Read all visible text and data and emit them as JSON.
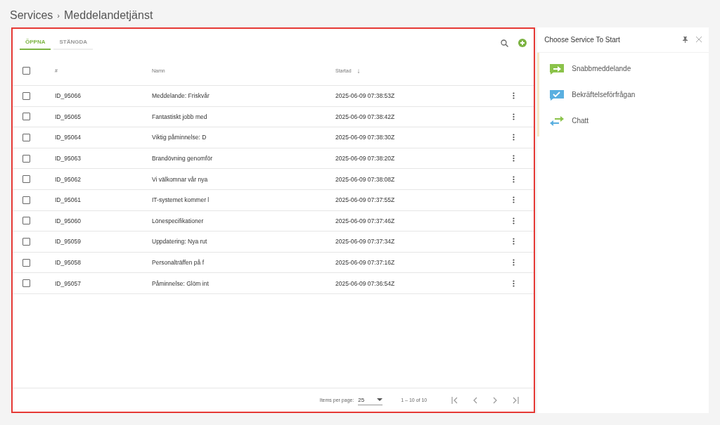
{
  "breadcrumb": {
    "parent": "Services",
    "separator": "›",
    "current": "Meddelandetjänst"
  },
  "tabs": [
    {
      "label": "ÖPPNA",
      "selected": true
    },
    {
      "label": "STÄNGDA",
      "selected": false
    }
  ],
  "table": {
    "all_checked": false,
    "columns": [
      "#",
      "Namn",
      "Startad"
    ],
    "sort_indicator": "↓",
    "rows": [
      {
        "id": "ID_95066",
        "name": "Meddelande: Friskvår",
        "started": "2025-06-09 07:38:53Z",
        "checked": false
      },
      {
        "id": "ID_95065",
        "name": "Fantastiskt jobb med",
        "started": "2025-06-09 07:38:42Z",
        "checked": false
      },
      {
        "id": "ID_95064",
        "name": "Viktig påminnelse: D",
        "started": "2025-06-09 07:38:30Z",
        "checked": false
      },
      {
        "id": "ID_95063",
        "name": "Brandövning genomför",
        "started": "2025-06-09 07:38:20Z",
        "checked": false
      },
      {
        "id": "ID_95062",
        "name": "Vi välkomnar vår nya",
        "started": "2025-06-09 07:38:08Z",
        "checked": false
      },
      {
        "id": "ID_95061",
        "name": "IT-systemet kommer l",
        "started": "2025-06-09 07:37:55Z",
        "checked": false
      },
      {
        "id": "ID_95060",
        "name": "Lönespecifikationer",
        "started": "2025-06-09 07:37:46Z",
        "checked": false
      },
      {
        "id": "ID_95059",
        "name": "Uppdatering: Nya rut",
        "started": "2025-06-09 07:37:34Z",
        "checked": false
      },
      {
        "id": "ID_95058",
        "name": "Personalträffen på f",
        "started": "2025-06-09 07:37:16Z",
        "checked": false
      },
      {
        "id": "ID_95057",
        "name": "Påminnelse: Glöm int",
        "started": "2025-06-09 07:36:54Z",
        "checked": false
      }
    ]
  },
  "paginator": {
    "label": "Items per page:",
    "page_size": "25",
    "range": "1 – 10 of 10"
  },
  "side_panel": {
    "title": "Choose Service To Start",
    "services": [
      {
        "label": "Snabbmeddelande",
        "kind": "message"
      },
      {
        "label": "Bekräftelseförfrågan",
        "kind": "confirm"
      },
      {
        "label": "Chatt",
        "kind": "chat"
      }
    ]
  }
}
